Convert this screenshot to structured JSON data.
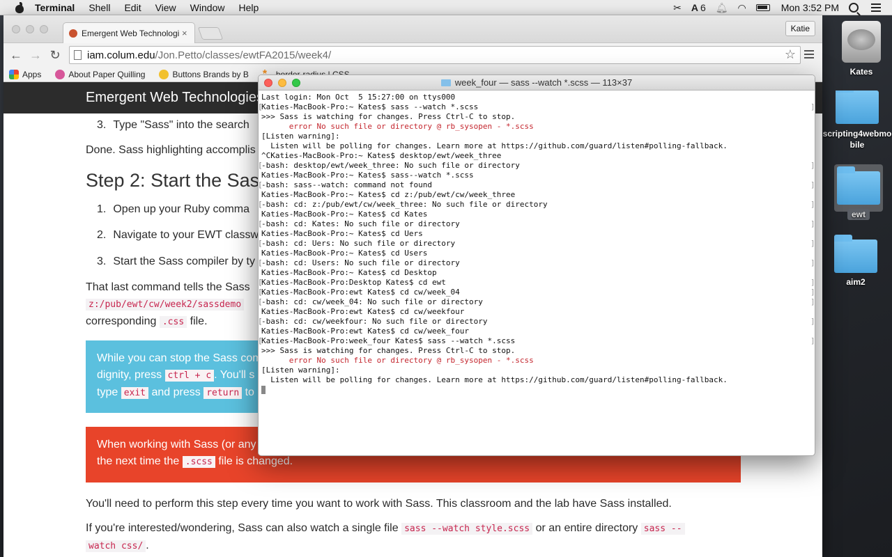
{
  "menubar": {
    "app_name": "Terminal",
    "items": [
      "Shell",
      "Edit",
      "View",
      "Window",
      "Help"
    ],
    "badge": "6",
    "clock": "Mon 3:52 PM"
  },
  "desktop": {
    "icons": [
      {
        "label": "Kates",
        "kind": "hdd-icon"
      },
      {
        "label": "scripting4webmobile",
        "kind": "folder-icon"
      },
      {
        "label": "ewt",
        "kind": "folder-icon"
      },
      {
        "label": "aim2",
        "kind": "folder-icon"
      }
    ]
  },
  "browser": {
    "tab_title": "Emergent Web Technologie",
    "profile": "Katie",
    "url_host": "iam.colum.edu",
    "url_path": "/Jon.Petto/classes/ewtFA2015/week4/",
    "bookmarks": [
      "Apps",
      "About Paper Quilling",
      "Buttons Brands by B",
      "border-radius | CSS"
    ]
  },
  "page": {
    "site_title": "Emergent Web Technologies",
    "step1_item3": "Type \"Sass\" into the search",
    "done_text": "Done. Sass highlighting accomplis",
    "step2_heading": "Step 2: Start the Sass",
    "step2_items": [
      "Open up your Ruby comma",
      "Navigate to your EWT classw",
      "Start the Sass compiler by ty"
    ],
    "last_cmd_text": "That last command tells the Sass",
    "path_code": "z:/pub/ewt/cw/week2/sassdemo",
    "corresponding_pre": "corresponding",
    "css_code": ".css",
    "corresponding_post": "file.",
    "blue_callout": {
      "line1": "While you can stop the Sass com",
      "line2_pre": "dignity, press",
      "ctrl_code": "ctrl + c",
      "line2_post": ". You'll s",
      "line3_pre": "type",
      "exit_code": "exit",
      "line3_mid": "and press",
      "return_code": "return",
      "line3_post": "to"
    },
    "red_callout": {
      "line1": "When working with Sass (or any",
      "line2_pre": "the next time the",
      "scss_code": ".scss",
      "line2_post": "file is changed."
    },
    "perform_text": "You'll need to perform this step every time you want to work with Sass. This classroom and the lab have Sass installed.",
    "interested_pre": "If you're interested/wondering, Sass can also watch a single file",
    "watch_file_code": "sass --watch style.scss",
    "interested_mid": "or an entire directory",
    "watch_dir_code1": "sass --",
    "watch_dir_code2": "watch css/",
    "interested_post": "."
  },
  "terminal": {
    "title": "week_four — sass --watch *.scss — 113×37",
    "lines": [
      {
        "text": "Last login: Mon Oct  5 15:27:00 on ttys000",
        "type": "plain"
      },
      {
        "text": "Katies-MacBook-Pro:~ Kates$ sass --watch *.scss",
        "type": "bracket"
      },
      {
        "text": ">>> Sass is watching for changes. Press Ctrl-C to stop.",
        "type": "plain"
      },
      {
        "text": "      error No such file or directory @ rb_sysopen - *.scss",
        "type": "err"
      },
      {
        "text": "[Listen warning]:",
        "type": "plain"
      },
      {
        "text": "  Listen will be polling for changes. Learn more at https://github.com/guard/listen#polling-fallback.",
        "type": "plain"
      },
      {
        "text": "^CKaties-MacBook-Pro:~ Kates$ desktop/ewt/week_three",
        "type": "plain"
      },
      {
        "text": "-bash: desktop/ewt/week_three: No such file or directory",
        "type": "bracket"
      },
      {
        "text": "Katies-MacBook-Pro:~ Kates$ sass--watch *.scss",
        "type": "plain"
      },
      {
        "text": "-bash: sass--watch: command not found",
        "type": "bracket"
      },
      {
        "text": "Katies-MacBook-Pro:~ Kates$ cd z:/pub/ewt/cw/week_three",
        "type": "plain"
      },
      {
        "text": "-bash: cd: z:/pub/ewt/cw/week_three: No such file or directory",
        "type": "bracket"
      },
      {
        "text": "Katies-MacBook-Pro:~ Kates$ cd Kates",
        "type": "plain"
      },
      {
        "text": "-bash: cd: Kates: No such file or directory",
        "type": "bracket"
      },
      {
        "text": "Katies-MacBook-Pro:~ Kates$ cd Uers",
        "type": "plain"
      },
      {
        "text": "-bash: cd: Uers: No such file or directory",
        "type": "bracket"
      },
      {
        "text": "Katies-MacBook-Pro:~ Kates$ cd Users",
        "type": "plain"
      },
      {
        "text": "-bash: cd: Users: No such file or directory",
        "type": "bracket"
      },
      {
        "text": "Katies-MacBook-Pro:~ Kates$ cd Desktop",
        "type": "plain"
      },
      {
        "text": "Katies-MacBook-Pro:Desktop Kates$ cd ewt",
        "type": "bracket"
      },
      {
        "text": "Katies-MacBook-Pro:ewt Kates$ cd cw/week_04",
        "type": "bracket"
      },
      {
        "text": "-bash: cd: cw/week_04: No such file or directory",
        "type": "bracket"
      },
      {
        "text": "Katies-MacBook-Pro:ewt Kates$ cd cw/weekfour",
        "type": "plain"
      },
      {
        "text": "-bash: cd: cw/weekfour: No such file or directory",
        "type": "bracket"
      },
      {
        "text": "Katies-MacBook-Pro:ewt Kates$ cd cw/week_four",
        "type": "plain"
      },
      {
        "text": "Katies-MacBook-Pro:week_four Kates$ sass --watch *.scss",
        "type": "bracket"
      },
      {
        "text": ">>> Sass is watching for changes. Press Ctrl-C to stop.",
        "type": "plain"
      },
      {
        "text": "      error No such file or directory @ rb_sysopen - *.scss",
        "type": "err"
      },
      {
        "text": "[Listen warning]:",
        "type": "plain"
      },
      {
        "text": "  Listen will be polling for changes. Learn more at https://github.com/guard/listen#polling-fallback.",
        "type": "plain"
      }
    ]
  }
}
